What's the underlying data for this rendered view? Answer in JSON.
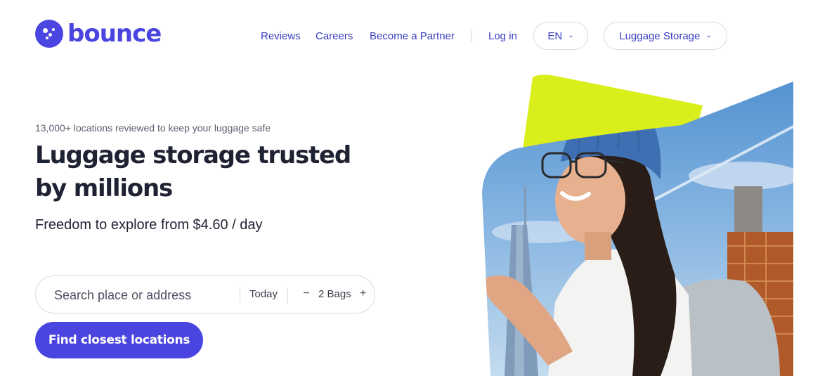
{
  "brand": {
    "name": "bounce",
    "accent": "#4a44e0",
    "highlight": "#d9ee1a"
  },
  "nav": {
    "reviews": "Reviews",
    "careers": "Careers",
    "partner": "Become a Partner",
    "login": "Log in",
    "language": "EN",
    "service": "Luggage Storage",
    "chevron_icon": "chevron-down-icon"
  },
  "hero": {
    "eyebrow": "13,000+ locations reviewed to keep your luggage safe",
    "headline": "Luggage storage trusted by millions",
    "subhead": "Freedom to explore from $4.60 / day"
  },
  "search": {
    "placeholder": "Search place or address",
    "value": "",
    "date": "Today",
    "bags": "2 Bags",
    "minus": "−",
    "plus": "+"
  },
  "cta": {
    "label": "Find closest locations"
  },
  "hero_image": {
    "subject": "smiling woman with glasses and blue beanie holding phone, city skyline behind"
  }
}
